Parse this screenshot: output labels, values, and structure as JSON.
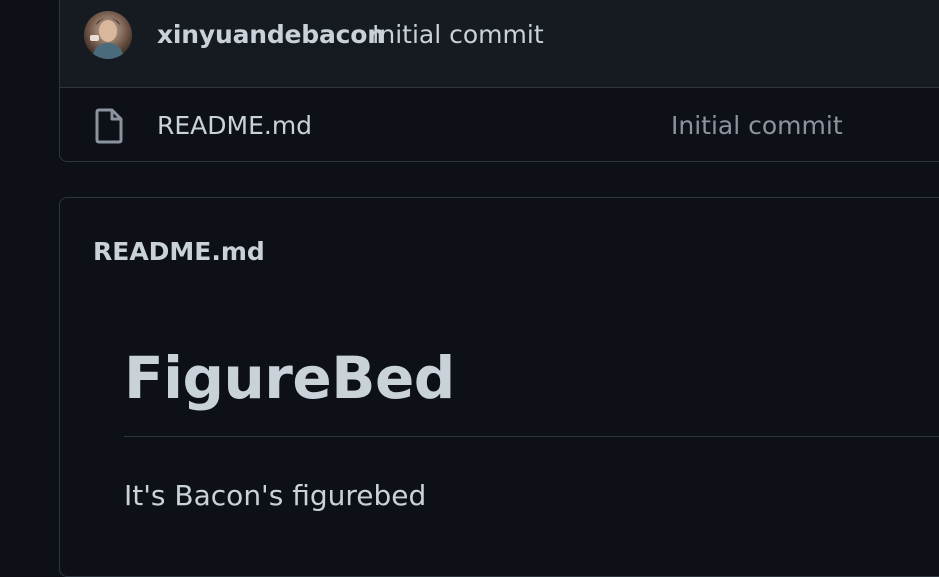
{
  "commit": {
    "author": "xinyuandebacon",
    "message": "Initial commit"
  },
  "files": [
    {
      "name": "README.md",
      "last_commit": "Initial commit",
      "icon": "file-icon"
    }
  ],
  "readme": {
    "filename": "README.md",
    "title": "FigureBed",
    "body": "It's Bacon's figurebed"
  },
  "colors": {
    "background": "#0d1117",
    "header_background": "#161b22",
    "border": "#30363d",
    "text": "#c9d1d9",
    "muted_text": "#8b949e"
  }
}
